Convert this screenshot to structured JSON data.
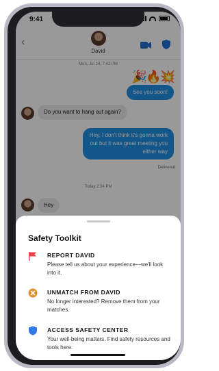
{
  "status_bar": {
    "time": "9:41"
  },
  "header": {
    "name": "David",
    "back_icon": "chevron-left-icon",
    "video_icon": "video-camera-icon",
    "safety_icon": "shield-icon"
  },
  "messages": {
    "date_1": "Mon, Jul 24, 7:42 PM",
    "emoji": "🎉🔥💥",
    "out_1": "See you soon!",
    "in_1": "Do you want to hang out again?",
    "out_2": "Hey, I don't think it's gonna work out but it was great meeting you either way",
    "delivered": "Delivered",
    "date_2": "Today 2:34 PM",
    "in_2": "Hey"
  },
  "toolkit": {
    "title": "Safety Toolkit",
    "options": [
      {
        "title": "REPORT DAVID",
        "desc": "Please tell us about your experience—we'll look into it.",
        "icon": "flag-icon",
        "color": "#e8424a"
      },
      {
        "title": "UNMATCH FROM DAVID",
        "desc": "No longer interested? Remove them from your matches.",
        "icon": "unmatch-x-icon",
        "color": "#e0902b"
      },
      {
        "title": "ACCESS SAFETY CENTER",
        "desc": "Your well-being matters. Find safety resources and tools here.",
        "icon": "shield-icon",
        "color": "#3378e8"
      }
    ]
  },
  "colors": {
    "accent": "#1f8fe6",
    "bubble_in": "#ececec"
  }
}
